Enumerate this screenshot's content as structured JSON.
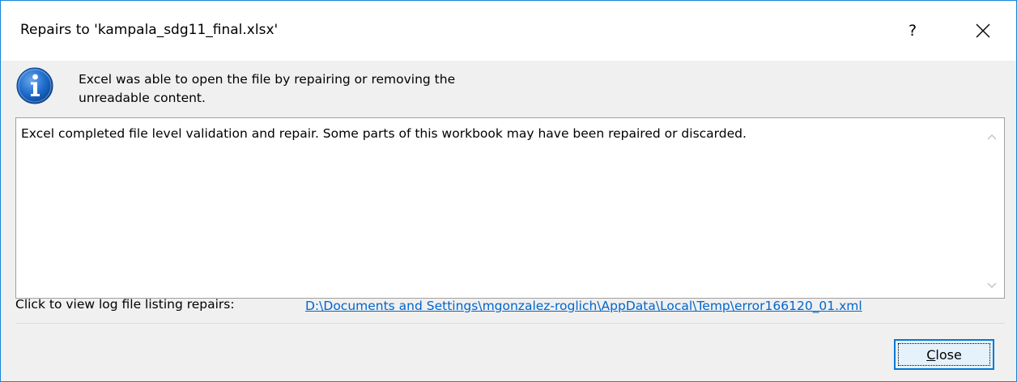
{
  "dialog": {
    "title": "Repairs to 'kampala_sdg11_final.xlsx'",
    "help_label": "?",
    "close_icon": "close-x-icon",
    "info_icon": "information-icon",
    "summary_line1": "Excel was able to open the file by repairing or removing the",
    "summary_line2": "unreadable content.",
    "details_text": "Excel completed file level validation and repair. Some parts of this workbook may have been repaired or discarded.",
    "log_label": "Click to view log file listing repairs:",
    "log_path": "D:\\Documents and Settings\\mgonzalez-roglich\\AppData\\Local\\Temp\\error166120_01.xml",
    "close_button_accel": "C",
    "close_button_rest": "lose"
  },
  "colors": {
    "border": "#1883d7",
    "link": "#0066cc",
    "info_blue": "#1a66c4",
    "button_bg": "#e5f1fb",
    "button_border": "#0078d7"
  }
}
